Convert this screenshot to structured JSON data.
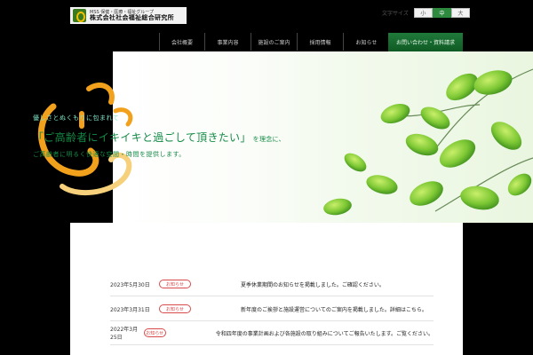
{
  "header": {
    "logo": {
      "sub": "MSS 保健・医療・福祉グループ",
      "main": "株式会社社会福祉総合研究所"
    },
    "font_size": {
      "label": "文字サイズ",
      "buttons": [
        "小",
        "中",
        "大"
      ],
      "active_index": 1
    },
    "nav": [
      "会社概要",
      "事業内容",
      "施設のご案内",
      "採用情報",
      "お知らせ"
    ],
    "cta": "お問い合わせ・資料請求"
  },
  "hero": {
    "lead": "優しさとぬくもりに包まれて",
    "title": "「ご高齢者にイキイキと過ごして頂きたい」",
    "title_after": "を理念に、",
    "sub": "ご高齢者に明るく快適な空間・時間を提供します。"
  },
  "news": {
    "items": [
      {
        "date": "2023年5月30日",
        "badge": "お知らせ",
        "title": "夏季休業期間のお知らせを掲載しました。ご確認ください。"
      },
      {
        "date": "2023年3月31日",
        "badge": "お知らせ",
        "title": "新年度のご挨拶と施設運営についてのご案内を掲載しました。詳細はこちら。"
      },
      {
        "date": "2022年3月25日",
        "badge": "お知らせ",
        "title": "令和四年度の事業計画および各施設の取り組みについてご報告いたします。ご覧ください。"
      }
    ]
  },
  "colors": {
    "brand_green": "#138a45",
    "cta_green": "#1f7a3a",
    "accent_orange": "#f2a11c",
    "badge_red": "#d84b4b"
  }
}
